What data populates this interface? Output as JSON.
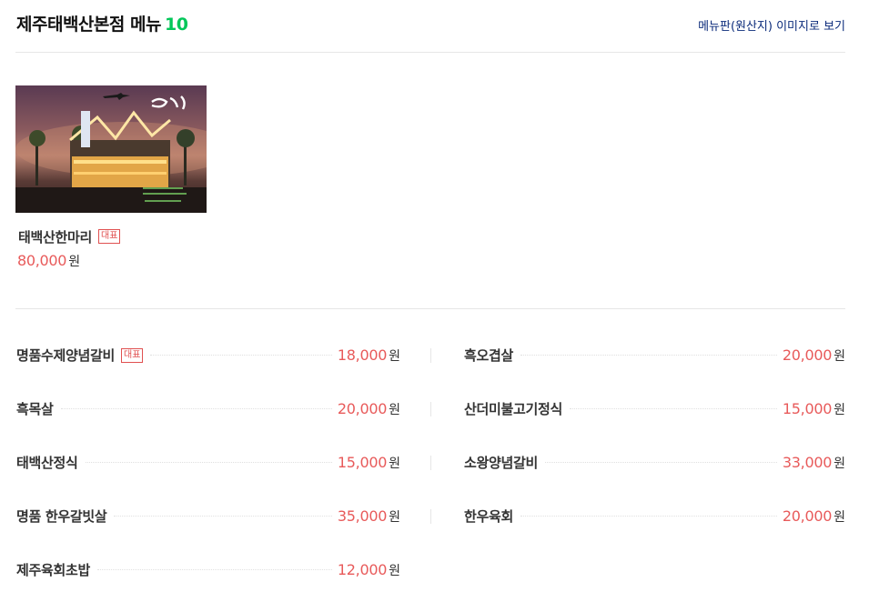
{
  "header": {
    "store_name": "제주태백산본점",
    "menu_label": "메뉴",
    "menu_count": "10",
    "menuboard_link": "메뉴판(원산지) 이미지로 보기"
  },
  "featured": {
    "name": "태백산한마리",
    "badge": "대표",
    "price": "80,000",
    "unit": "원"
  },
  "menu_items": [
    {
      "name": "명품수제양념갈비",
      "badge": "대표",
      "price": "18,000",
      "unit": "원"
    },
    {
      "name": "흑오겹살",
      "badge": "",
      "price": "20,000",
      "unit": "원"
    },
    {
      "name": "흑목살",
      "badge": "",
      "price": "20,000",
      "unit": "원"
    },
    {
      "name": "산더미불고기정식",
      "badge": "",
      "price": "15,000",
      "unit": "원"
    },
    {
      "name": "태백산정식",
      "badge": "",
      "price": "15,000",
      "unit": "원"
    },
    {
      "name": "소왕양념갈비",
      "badge": "",
      "price": "33,000",
      "unit": "원"
    },
    {
      "name": "명품 한우갈빗살",
      "badge": "",
      "price": "35,000",
      "unit": "원"
    },
    {
      "name": "한우육회",
      "badge": "",
      "price": "20,000",
      "unit": "원"
    },
    {
      "name": "제주육회초밥",
      "badge": "",
      "price": "12,000",
      "unit": "원"
    }
  ],
  "colors": {
    "accent_count": "#03c75a",
    "price": "#e85a5a",
    "link": "#0a2a7a",
    "badge": "#e05050"
  }
}
